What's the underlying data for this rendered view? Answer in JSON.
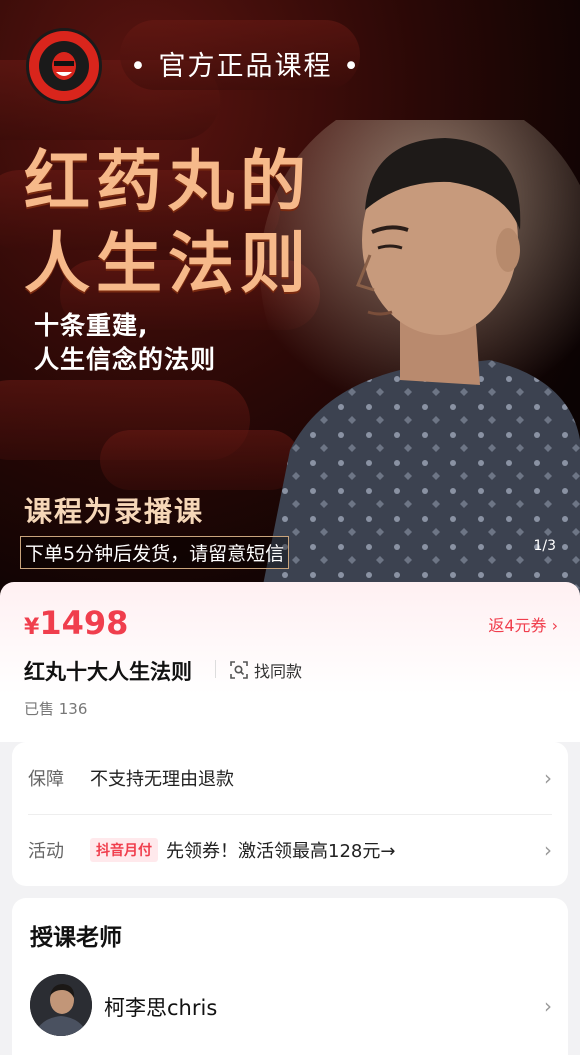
{
  "banner": {
    "badge": "• 官方正品课程 •",
    "title_line1": "红药丸的",
    "title_line2": "人生法则",
    "subtitle_line1": "十条重建,",
    "subtitle_line2": "人生信念的法则",
    "record_note": "课程为录播课",
    "shipping_note": "下单5分钟后发货，请留意短信",
    "pager": "1/3",
    "logo_text": "THE RED PILL"
  },
  "product": {
    "currency": "¥",
    "price": "1498",
    "coupon": "返4元券",
    "title": "红丸十大人生法则",
    "find_same": "找同款",
    "sold": "已售 136"
  },
  "info": {
    "guarantee_label": "保障",
    "guarantee_value": "不支持无理由退款",
    "activity_label": "活动",
    "activity_tag": "抖音月付",
    "activity_value": "先领券！激活领最高128元→"
  },
  "teacher": {
    "heading": "授课老师",
    "name": "柯李思chris"
  },
  "colors": {
    "accent": "#f03e4d",
    "title_gold": "#f6b98a",
    "banner_dark": "#0b0303"
  }
}
